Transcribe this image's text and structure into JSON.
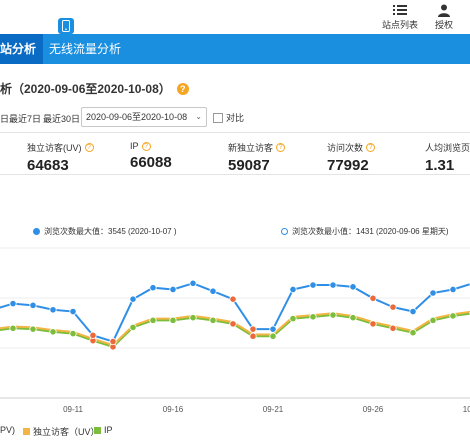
{
  "header": {
    "site_list_label": "站点列表",
    "auth_label": "授权",
    "site_list_icon": "list-icon",
    "auth_icon": "user-icon"
  },
  "nav": {
    "active_tab": "站分析",
    "wireless_tab": "无线流量分析",
    "phone_icon": "phone-icon"
  },
  "report": {
    "title": "析（2020-09-06至2020-10-08）"
  },
  "filters": {
    "period_partial": "日",
    "last7": "最近7日",
    "last30": "最近30日",
    "date_range": "2020-09-06至2020-10-08",
    "compare_label": "对比",
    "compare_checked": false
  },
  "stats": [
    {
      "label": "独立访客(UV)",
      "value": "64683"
    },
    {
      "label": "IP",
      "value": "66088"
    },
    {
      "label": "新独立访客",
      "value": "59087"
    },
    {
      "label": "访问次数",
      "value": "77992"
    },
    {
      "label": "人均浏览页",
      "value": "1.31"
    }
  ],
  "chart_legend": {
    "max_label": "浏览次数最大值：3545 (2020-10-07 )",
    "min_label": "浏览次数最小值：1431 (2020-09-06 星期天)"
  },
  "colors": {
    "nav_bg": "#1a8fe0",
    "nav_active": "#0a6bc4",
    "pv": "#2f8fe6",
    "uv": "#f0b542",
    "ip": "#7cbd3b",
    "weekend": "#ec6a3a",
    "help": "#f5a623"
  },
  "chart_data": {
    "type": "line",
    "x": [
      "09-07",
      "09-08",
      "09-09",
      "09-10",
      "09-11",
      "09-12",
      "09-13",
      "09-14",
      "09-15",
      "09-16",
      "09-17",
      "09-18",
      "09-19",
      "09-20",
      "09-21",
      "09-22",
      "09-23",
      "09-24",
      "09-25",
      "09-26",
      "09-27",
      "09-28",
      "09-29",
      "09-30",
      "10-01",
      "10-02",
      "10-03",
      "10-04",
      "10-05",
      "10-06",
      "10-07",
      "10-08"
    ],
    "x_ticks": [
      "09-11",
      "09-16",
      "09-21",
      "09-26",
      "10-01"
    ],
    "weekend_indices": [
      5,
      6,
      12,
      13,
      19,
      20,
      26,
      27
    ],
    "series": [
      {
        "name": "PV",
        "values": [
          2800,
          2870,
          2850,
          2800,
          2780,
          2510,
          2440,
          2920,
          3050,
          3030,
          3100,
          3010,
          2920,
          2580,
          2580,
          3030,
          3080,
          3080,
          3060,
          2930,
          2830,
          2780,
          2990,
          3030,
          3100,
          3050,
          3020,
          3050,
          3090,
          3110,
          3140,
          3100
        ]
      },
      {
        "name": "独立访客（UV）",
        "values": [
          2580,
          2610,
          2600,
          2570,
          2550,
          2470,
          2400,
          2620,
          2700,
          2700,
          2730,
          2700,
          2660,
          2520,
          2520,
          2720,
          2740,
          2760,
          2730,
          2660,
          2610,
          2560,
          2700,
          2750,
          2780,
          2760,
          2760,
          2790,
          2820,
          2850,
          2860,
          2820
        ]
      },
      {
        "name": "IP",
        "values": [
          2560,
          2590,
          2580,
          2550,
          2530,
          2450,
          2380,
          2600,
          2680,
          2680,
          2710,
          2680,
          2640,
          2500,
          2500,
          2700,
          2720,
          2740,
          2710,
          2640,
          2590,
          2540,
          2680,
          2730,
          2760,
          2740,
          2740,
          2770,
          2800,
          2830,
          2840,
          2800
        ]
      }
    ],
    "legend_labels_visible": [
      "PV)",
      "独立访客（UV）",
      "IP"
    ],
    "ylim": [
      1800,
      3500
    ]
  }
}
